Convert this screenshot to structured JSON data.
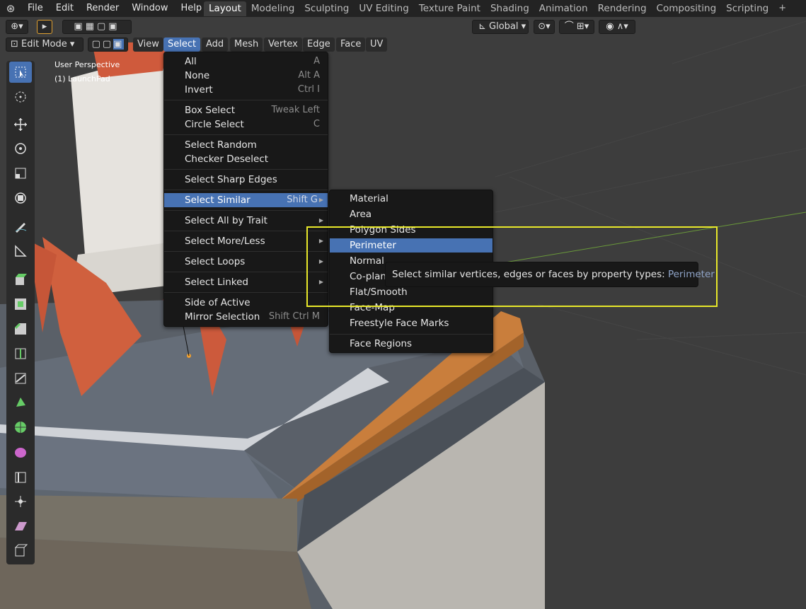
{
  "app": {
    "menus": [
      "File",
      "Edit",
      "Render",
      "Window",
      "Help"
    ],
    "workspaces": [
      "Layout",
      "Modeling",
      "Sculpting",
      "UV Editing",
      "Texture Paint",
      "Shading",
      "Animation",
      "Rendering",
      "Compositing",
      "Scripting"
    ],
    "active_workspace": "Layout",
    "add_workspace": "+"
  },
  "header": {
    "mode": "Edit Mode",
    "menus": [
      "View",
      "Select",
      "Add",
      "Mesh",
      "Vertex",
      "Edge",
      "Face",
      "UV"
    ],
    "active_menu": "Select",
    "orientation": "Global"
  },
  "viewport": {
    "perspective": "User Perspective",
    "object": "(1) LaunchPad"
  },
  "select_menu": {
    "items": [
      {
        "label": "All",
        "shortcut": "A"
      },
      {
        "label": "None",
        "shortcut": "Alt A"
      },
      {
        "label": "Invert",
        "shortcut": "Ctrl I"
      },
      {
        "label": "Box Select",
        "shortcut": "Tweak Left"
      },
      {
        "label": "Circle Select",
        "shortcut": "C"
      },
      {
        "label": "Select Random",
        "shortcut": ""
      },
      {
        "label": "Checker Deselect",
        "shortcut": ""
      },
      {
        "label": "Select Sharp Edges",
        "shortcut": ""
      },
      {
        "label": "Select Similar",
        "shortcut": "Shift G"
      },
      {
        "label": "Select All by Trait",
        "shortcut": ""
      },
      {
        "label": "Select More/Less",
        "shortcut": ""
      },
      {
        "label": "Select Loops",
        "shortcut": ""
      },
      {
        "label": "Select Linked",
        "shortcut": ""
      },
      {
        "label": "Side of Active",
        "shortcut": ""
      },
      {
        "label": "Mirror Selection",
        "shortcut": "Shift Ctrl M"
      }
    ]
  },
  "similar_menu": {
    "items": [
      "Material",
      "Area",
      "Polygon Sides",
      "Perimeter",
      "Normal",
      "Co-plan",
      "Flat/Smooth",
      "Face-Map",
      "Freestyle Face Marks",
      "Face Regions"
    ],
    "highlighted": "Perimeter"
  },
  "tooltip": {
    "text": "Select similar vertices, edges or faces by property types:",
    "value": "Perimeter"
  },
  "colors": {
    "accent": "#4772b3",
    "highlight_box": "#e8e82a"
  }
}
